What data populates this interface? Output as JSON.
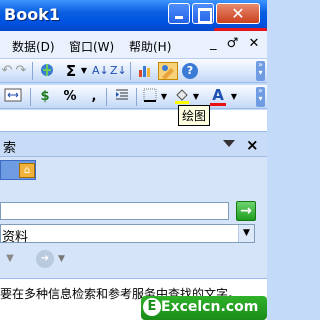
{
  "window": {
    "title": "Book1",
    "close_glyph": "✕"
  },
  "menubar": {
    "items": [
      {
        "label": "数据(D)"
      },
      {
        "label": "窗口(W)"
      },
      {
        "label": "帮助(H)"
      }
    ],
    "right_glyphs": [
      "_",
      "♂",
      "✕"
    ]
  },
  "toolbar1": {
    "undo": "↶",
    "redo": "↷",
    "sum": "Σ",
    "sort_asc": "A↓",
    "sort_desc": "Z↓",
    "help": "?"
  },
  "toolbar2": {
    "currency": "$",
    "percent": "%",
    "comma": ",",
    "font_color": "A"
  },
  "tooltip": {
    "text": "绘图"
  },
  "taskpane": {
    "title": "索",
    "dropdown_glyph": "▼",
    "close_glyph": "×",
    "search_placeholder": "",
    "go_glyph": "→",
    "scope_value": "资料",
    "info_text": "要在多种信息检索和参考服务中查找的文字。"
  },
  "watermark": {
    "text": "Excelcn.com",
    "letter": "E"
  },
  "colors": {
    "title_blue": "#0054e3",
    "close_red": "#c9401e",
    "mark_red": "#e8141c",
    "pane_bg": "#d6e4f9",
    "logo_green": "#1a8c18"
  }
}
